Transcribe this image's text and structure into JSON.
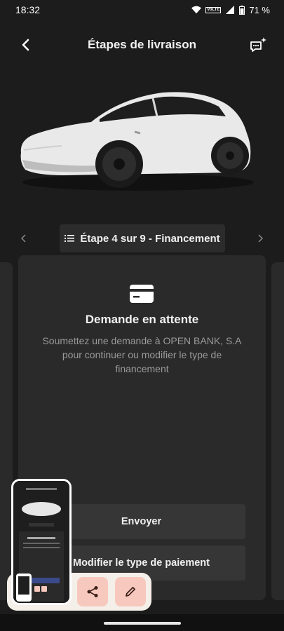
{
  "status_bar": {
    "time": "18:32",
    "network": "VoLTE",
    "battery": "71 %",
    "icons": [
      "wifi-icon",
      "signal-icon",
      "battery-icon"
    ]
  },
  "header": {
    "title": "Étapes de livraison",
    "back_icon": "chevron-left-icon",
    "chat_icon": "chat-sparkle-icon"
  },
  "step_nav": {
    "label": "Étape 4 sur 9 - Financement",
    "list_icon": "list-icon",
    "current_step": 4,
    "total_steps": 9
  },
  "card": {
    "icon": "credit-card-icon",
    "title": "Demande en attente",
    "description": "Soumettez une demande à OPEN BANK, S.A pour continuer ou modifier le type de financement",
    "send_label": "Envoyer",
    "modify_label": "Modifier le type de paiement"
  },
  "screenshot_toolbar": {
    "share_icon": "share-icon",
    "edit_icon": "pencil-icon"
  },
  "colors": {
    "background": "#1c1c1c",
    "card": "#2a2a2a",
    "button": "#363636",
    "toolbar_bg": "#f5efe9",
    "toolbar_btn": "#f7c9be"
  }
}
